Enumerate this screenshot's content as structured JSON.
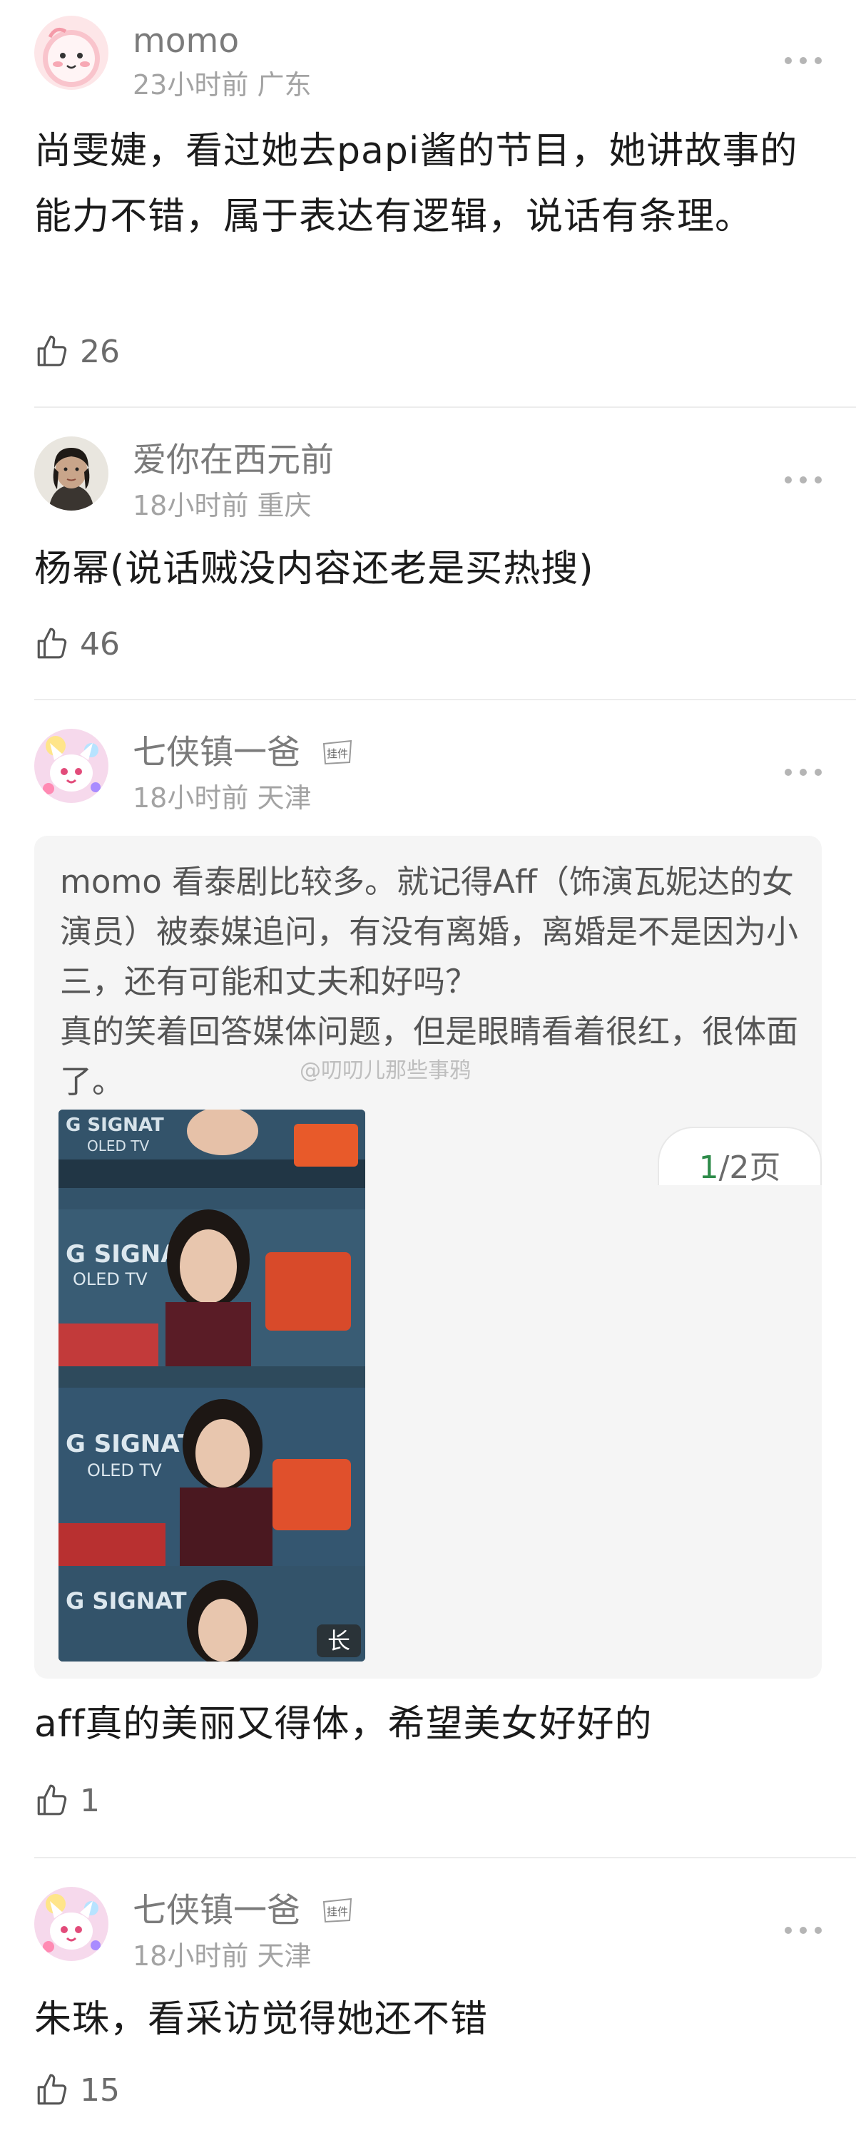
{
  "comments": [
    {
      "username": "momo",
      "time": "23小时前",
      "location": "广东",
      "text": "尚雯婕，看过她去papi酱的节目，她讲故事的能力不错，属于表达有逻辑，说话有条理。",
      "likes": "26"
    },
    {
      "username": "爱你在西元前",
      "time": "18小时前",
      "location": "重庆",
      "text": "杨幂(说话贼没内容还老是买热搜)",
      "likes": "46"
    },
    {
      "username": "七侠镇一爸",
      "pendant_label": "挂件",
      "time": "18小时前",
      "location": "天津",
      "quote": "momo 看泰剧比较多。就记得Aff（饰演瓦妮达的女演员）被泰媒追问，有没有离婚，离婚是不是因为小三，还有可能和丈夫和好吗？\n真的笑着回答媒体问题，但是眼睛看着很红，很体面了。",
      "watermark": "@叨叨儿那些事鸦",
      "image_badge": "长",
      "pager_current": "1",
      "pager_rest": "/2页",
      "text": "aff真的美丽又得体，希望美女好好的",
      "likes": "1"
    },
    {
      "username": "七侠镇一爸",
      "pendant_label": "挂件",
      "time": "18小时前",
      "location": "天津",
      "text": "朱珠，看采访觉得她还不错",
      "likes": "15"
    }
  ],
  "icons": {
    "more": "more-dots-icon",
    "like": "thumbs-up-icon"
  },
  "colors": {
    "username": "#7b7b7b",
    "meta": "#a3a3a3",
    "pager_current": "#2e8b4a",
    "quote_bg": "#f5f5f5"
  }
}
